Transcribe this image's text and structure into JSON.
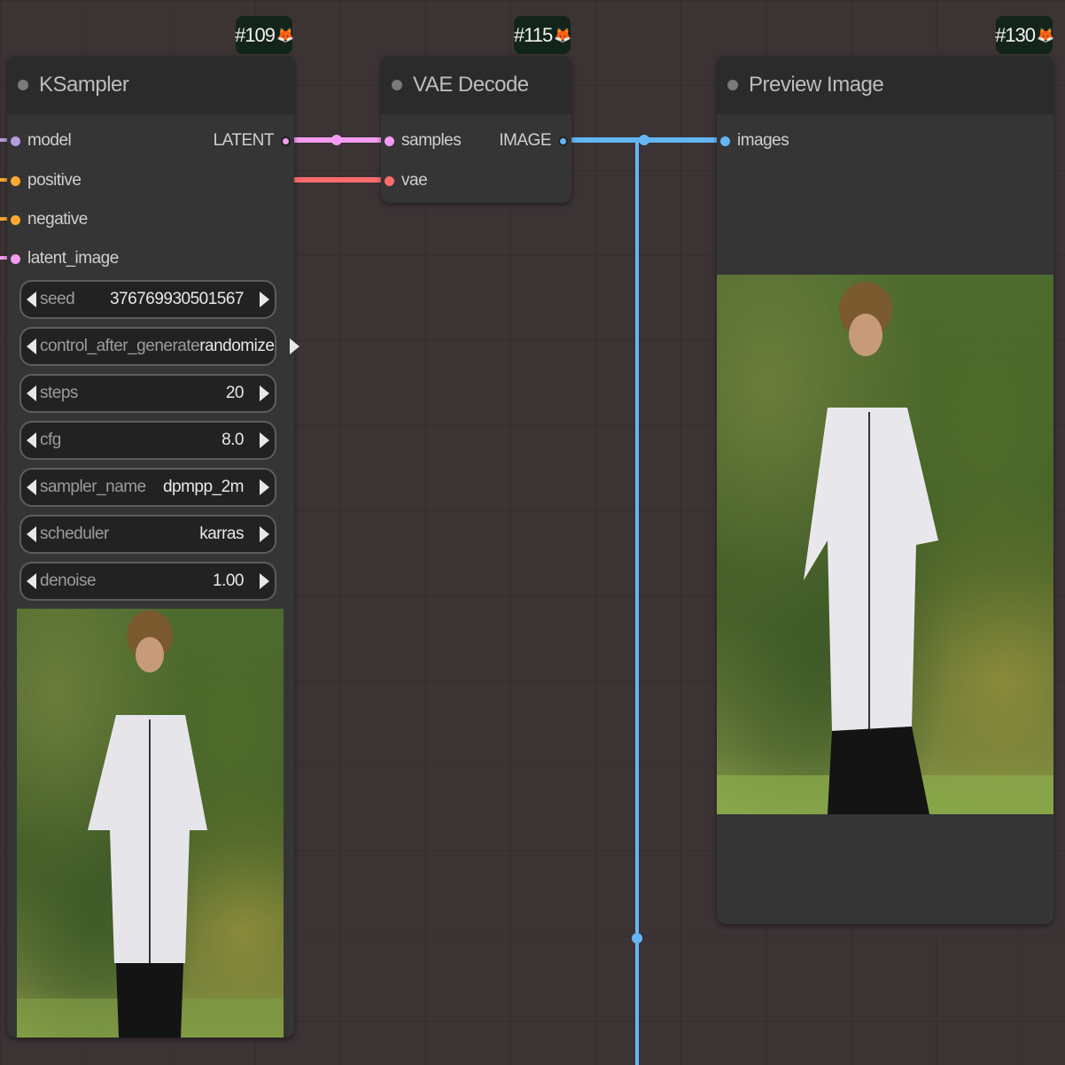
{
  "badges": {
    "ksampler": "#109",
    "vae_decode": "#115",
    "preview": "#130"
  },
  "ksampler": {
    "title": "KSampler",
    "inputs": [
      "model",
      "positive",
      "negative",
      "latent_image"
    ],
    "output": "LATENT",
    "widgets": [
      {
        "label": "seed",
        "value": "376769930501567"
      },
      {
        "label": "control_after_generate",
        "value": "randomize"
      },
      {
        "label": "steps",
        "value": "20"
      },
      {
        "label": "cfg",
        "value": "8.0"
      },
      {
        "label": "sampler_name",
        "value": "dpmpp_2m"
      },
      {
        "label": "scheduler",
        "value": "karras"
      },
      {
        "label": "denoise",
        "value": "1.00"
      }
    ]
  },
  "vae_decode": {
    "title": "VAE Decode",
    "inputs": [
      "samples",
      "vae"
    ],
    "output": "IMAGE"
  },
  "preview_image": {
    "title": "Preview Image",
    "inputs": [
      "images"
    ]
  },
  "colors": {
    "latent": "#f39bf0",
    "image": "#64b5f6",
    "vae": "#ff6b6b",
    "model": "#b39ddb",
    "conditioning": "#ffa931",
    "background": "#3b3334",
    "node": "#353535"
  },
  "icons": [
    "fox-icon"
  ]
}
